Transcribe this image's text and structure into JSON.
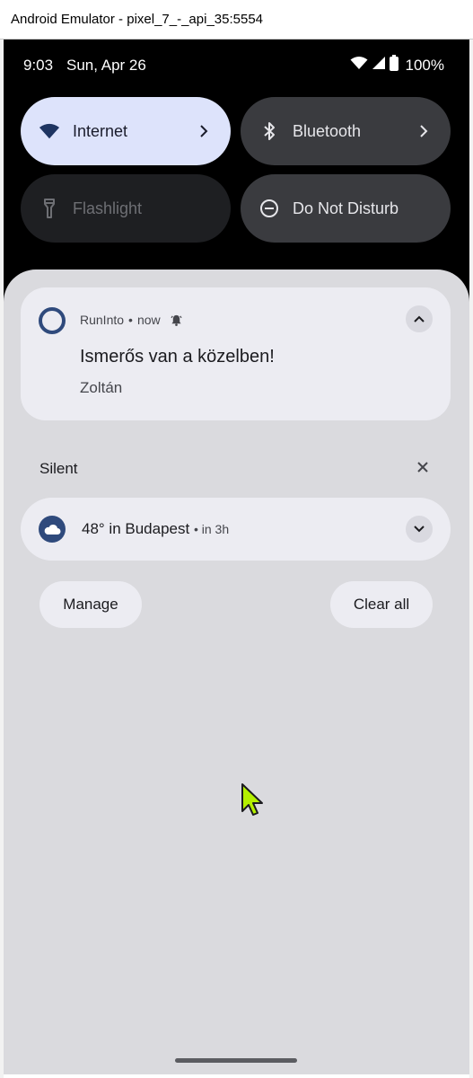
{
  "window": {
    "title": "Android Emulator - pixel_7_-_api_35:5554"
  },
  "status_bar": {
    "time": "9:03",
    "date": "Sun, Apr 26",
    "battery": "100%",
    "icons": [
      "wifi-icon",
      "cellular-signal-icon",
      "battery-icon"
    ]
  },
  "quick_settings": {
    "tiles": [
      {
        "label": "Internet",
        "icon": "wifi-icon",
        "state": "on",
        "has_chevron": true
      },
      {
        "label": "Bluetooth",
        "icon": "bluetooth-icon",
        "state": "off",
        "has_chevron": true
      },
      {
        "label": "Flashlight",
        "icon": "flashlight-icon",
        "state": "unavailable",
        "has_chevron": false
      },
      {
        "label": "Do Not Disturb",
        "icon": "do-not-disturb-icon",
        "state": "off",
        "has_chevron": false
      }
    ]
  },
  "notifications": {
    "alerting": {
      "app_name": "RunInto",
      "time": "now",
      "title": "Ismerős van a közelben!",
      "text": "Zoltán"
    },
    "silent_section": {
      "label": "Silent",
      "weather": {
        "title": "48° in Budapest",
        "sub": "in 3h"
      }
    },
    "actions": {
      "manage": "Manage",
      "clear_all": "Clear all"
    }
  },
  "colors": {
    "accent_tile": "#dde3fb",
    "shade_background": "#dadade",
    "card_background": "#ececf2",
    "app_icon": "#2f4a7c",
    "cursor": "#b4f000"
  }
}
